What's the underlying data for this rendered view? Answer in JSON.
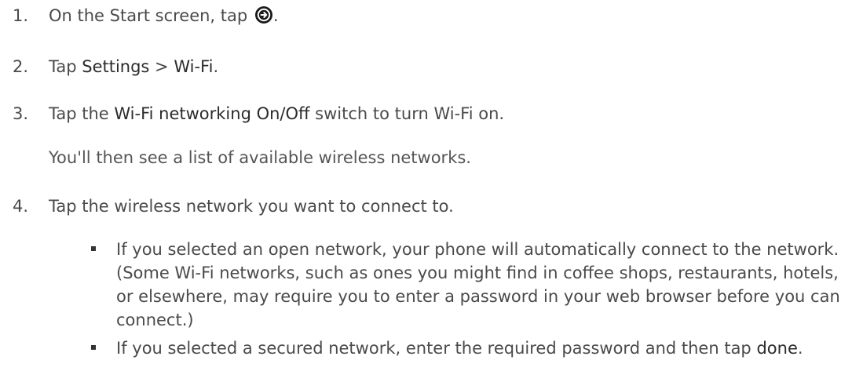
{
  "steps": [
    {
      "num": "1.",
      "parts": {
        "before": "On the Start screen, tap",
        "after": "."
      },
      "icon": "arrow-right-circle-icon"
    },
    {
      "num": "2.",
      "parts": {
        "before": "Tap ",
        "em1": "Settings",
        "mid": " > ",
        "em2": "Wi-Fi",
        "after": "."
      }
    },
    {
      "num": "3.",
      "parts": {
        "before": "Tap the ",
        "em1": "Wi-Fi networking On/Off",
        "after": " switch to turn Wi-Fi on."
      },
      "note": "You'll then see a list of available wireless networks."
    },
    {
      "num": "4.",
      "parts": {
        "before": "Tap the wireless network you want to connect to."
      },
      "bullets": [
        {
          "text": "If you selected an open network, your phone will automatically connect to the network. (Some Wi-Fi networks, such as ones you might find in coffee shops, restaurants, hotels, or elsewhere, may require you to enter a password in your web browser before you can connect.)"
        },
        {
          "before": "If you selected a secured network, enter the required password and then tap ",
          "em": "done",
          "after": "."
        }
      ]
    }
  ]
}
